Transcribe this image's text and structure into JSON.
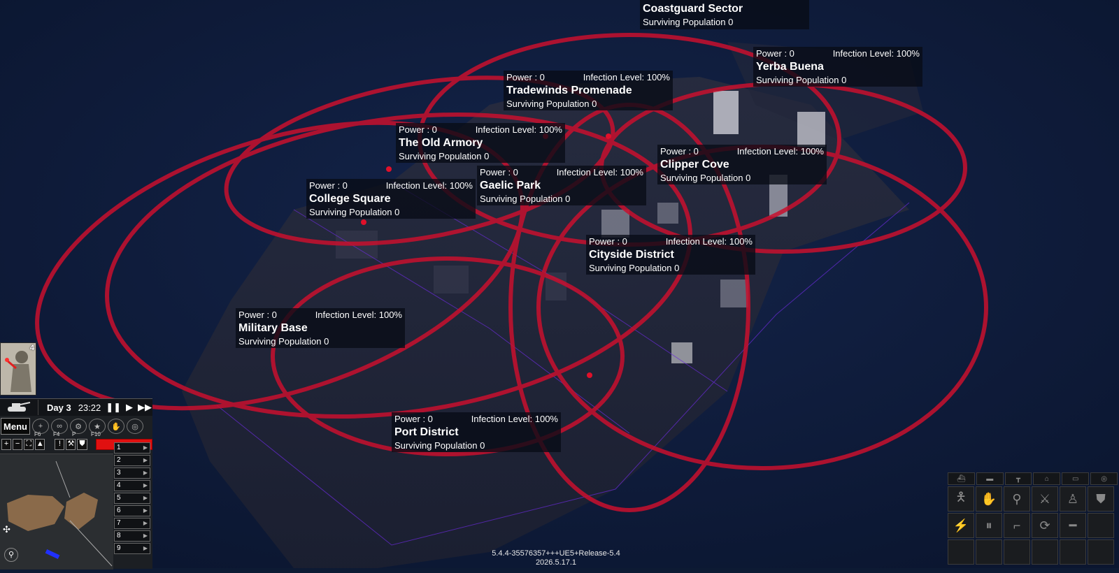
{
  "districts": [
    {
      "name": "Coastguard Sector",
      "power": "",
      "infection": "",
      "population": "Surviving Population 0"
    },
    {
      "name": "Yerba Buena",
      "power": "Power : 0",
      "infection": "Infection Level: 100%",
      "population": "Surviving Population 0"
    },
    {
      "name": "Tradewinds Promenade",
      "power": "Power : 0",
      "infection": "Infection Level: 100%",
      "population": "Surviving Population 0"
    },
    {
      "name": "The Old Armory",
      "power": "Power : 0",
      "infection": "Infection Level: 100%",
      "population": "Surviving Population 0"
    },
    {
      "name": "Clipper Cove",
      "power": "Power : 0",
      "infection": "Infection Level: 100%",
      "population": "Surviving Population 0"
    },
    {
      "name": "Gaelic Park",
      "power": "Power : 0",
      "infection": "Infection Level: 100%",
      "population": "Surviving Population 0"
    },
    {
      "name": "College Square",
      "power": "Power : 0",
      "infection": "Infection Level: 100%",
      "population": "Surviving Population 0"
    },
    {
      "name": "Cityside District",
      "power": "Power : 0",
      "infection": "Infection Level: 100%",
      "population": "Surviving Population 0"
    },
    {
      "name": "Military Base",
      "power": "Power : 0",
      "infection": "Infection Level: 100%",
      "population": "Surviving Population 0"
    },
    {
      "name": "Port District",
      "power": "Power : 0",
      "infection": "Infection Level: 100%",
      "population": "Surviving Population 0"
    }
  ],
  "hud": {
    "unit_count": "4",
    "day": "Day 3",
    "time": "23:22",
    "menu_label": "Menu",
    "hotkeys": [
      "F6",
      "F4",
      "P",
      "F10"
    ],
    "groups": [
      "1",
      "2",
      "3",
      "4",
      "5",
      "6",
      "7",
      "8",
      "9"
    ]
  },
  "build": {
    "version": "5.4.4-35576357+++UE5+Release-5.4",
    "date": "2026.5.17.1"
  },
  "colors": {
    "infection_ring": "#c8102e",
    "water": "#0d1a33",
    "alert": "#e01010"
  },
  "icons": {
    "cmd_tabs": [
      "boat-icon",
      "truck-icon",
      "trailer-icon",
      "garage-icon",
      "bus-icon",
      "shield-icon"
    ],
    "cmd_actions": [
      "soldier-aim-icon",
      "halt-hand-icon",
      "walk-icon",
      "knife-icon",
      "stand-icon",
      "badge-icon",
      "flashlight-icon",
      "pause-icon",
      "pistol-icon",
      "reload-icon",
      "minus-icon",
      "empty-icon"
    ]
  }
}
